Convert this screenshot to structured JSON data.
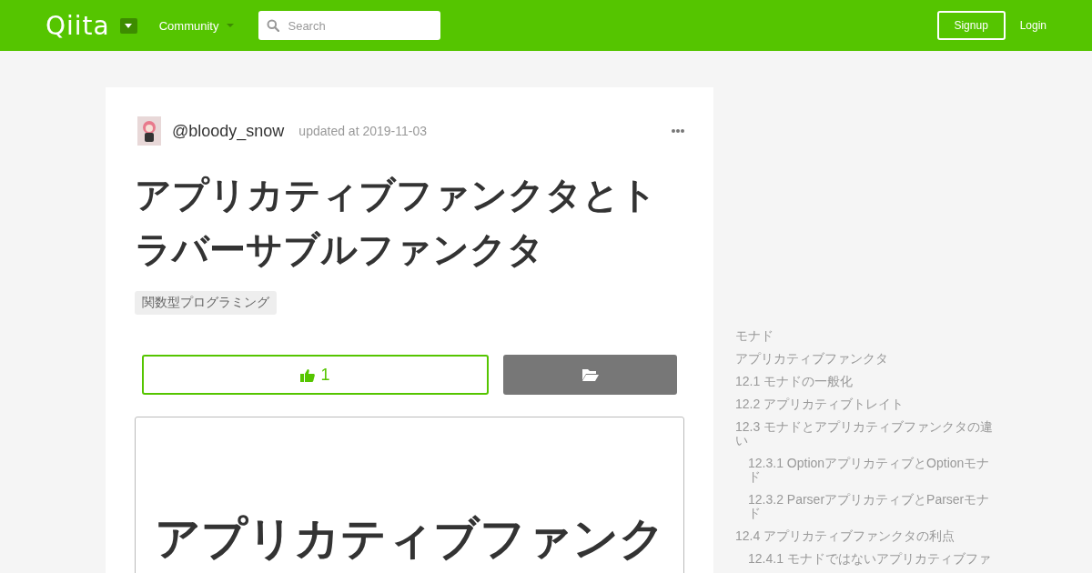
{
  "header": {
    "logo": "Qiita",
    "community": "Community",
    "search": {
      "placeholder": "Search"
    },
    "signup": "Signup",
    "login": "Login"
  },
  "article": {
    "author": "@bloody_snow",
    "updated": "updated at 2019-11-03",
    "title": "アプリカティブファンクタとトラバーサブルファンクタ",
    "tags": [
      "関数型プログラミング"
    ],
    "likes": "1",
    "cover_text": "アプリカティブファンク"
  },
  "toc": [
    {
      "label": "モナド"
    },
    {
      "label": "アプリカティブファンクタ"
    },
    {
      "label": "12.1 モナドの一般化"
    },
    {
      "label": "12.2 アプリカティブトレイト"
    },
    {
      "label": "12.3 モナドとアプリカティブファンクタの違い",
      "children": [
        {
          "label": "12.3.1 OptionアプリカティブとOptionモナド"
        },
        {
          "label": "12.3.2 ParserアプリカティブとParserモナド"
        }
      ]
    },
    {
      "label": "12.4 アプリカティブファンクタの利点",
      "children": [
        {
          "label": "12.4.1 モナドではないアプリカティブファ"
        }
      ]
    }
  ]
}
